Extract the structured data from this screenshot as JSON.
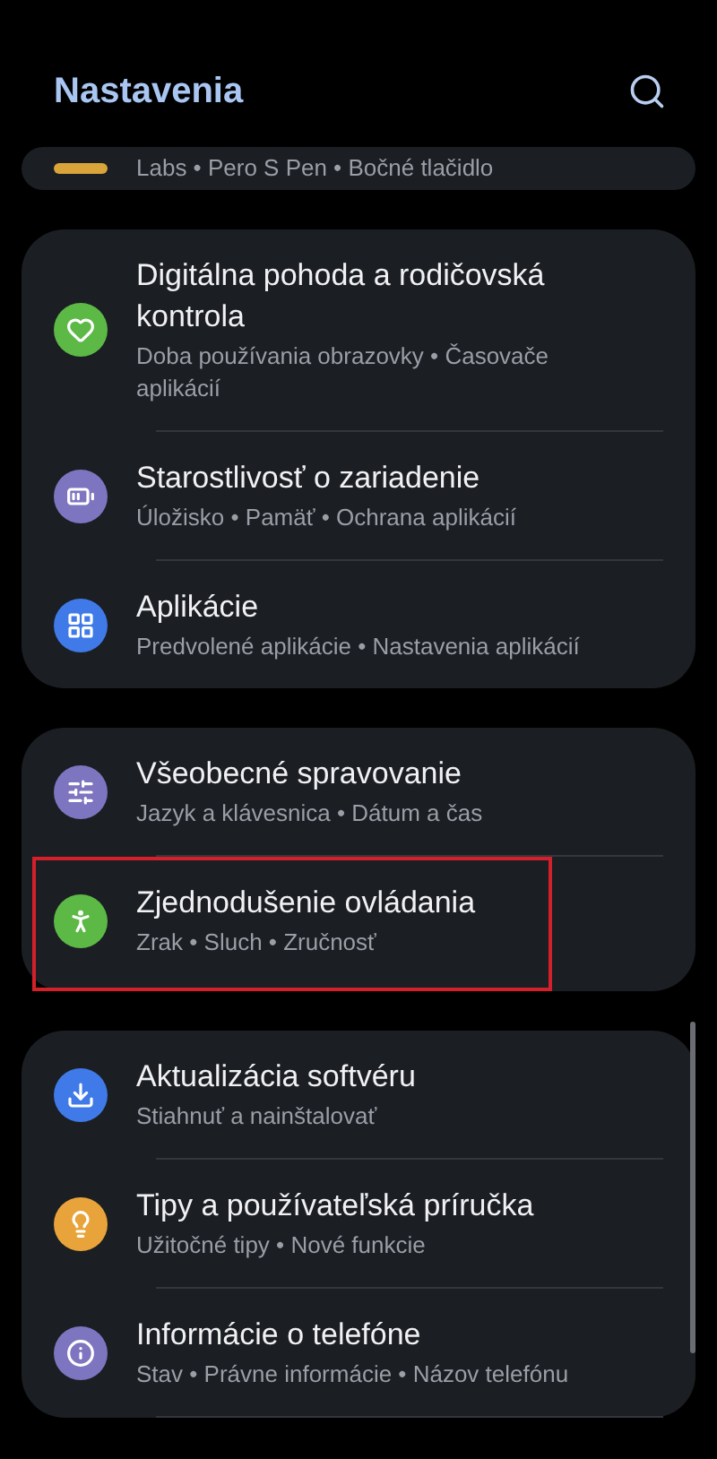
{
  "header": {
    "title": "Nastavenia"
  },
  "groups": [
    {
      "items": [
        {
          "subtitle": "Labs • Pero S Pen • Bočné tlačidlo",
          "color": "#d9a43a",
          "highlighted": false
        }
      ]
    },
    {
      "items": [
        {
          "title": "Digitálna pohoda a rodičovská kontrola",
          "subtitle": "Doba používania obrazovky • Časovače aplikácií",
          "color": "#5cb946",
          "highlighted": false
        },
        {
          "title": "Starostlivosť o zariadenie",
          "subtitle": "Úložisko • Pamäť • Ochrana aplikácií",
          "color": "#7d75c0",
          "highlighted": false
        },
        {
          "title": "Aplikácie",
          "subtitle": "Predvolené aplikácie • Nastavenia aplikácií",
          "color": "#3f7ae8",
          "highlighted": false
        }
      ]
    },
    {
      "items": [
        {
          "title": "Všeobecné spravovanie",
          "subtitle": "Jazyk a klávesnica • Dátum a čas",
          "color": "#7d75c0",
          "highlighted": false
        },
        {
          "title": "Zjednodušenie ovládania",
          "subtitle": "Zrak • Sluch • Zručnosť",
          "color": "#5cb946",
          "highlighted": true
        }
      ]
    },
    {
      "items": [
        {
          "title": "Aktualizácia softvéru",
          "subtitle": "Stiahnuť a nainštalovať",
          "color": "#3f7ae8",
          "highlighted": false
        },
        {
          "title": "Tipy a používateľská príručka",
          "subtitle": "Užitočné tipy • Nové funkcie",
          "color": "#e8a43a",
          "highlighted": false
        },
        {
          "title": "Informácie o telefóne",
          "subtitle": "Stav • Právne informácie • Názov telefónu",
          "color": "#7d75c0",
          "highlighted": false
        }
      ]
    }
  ]
}
